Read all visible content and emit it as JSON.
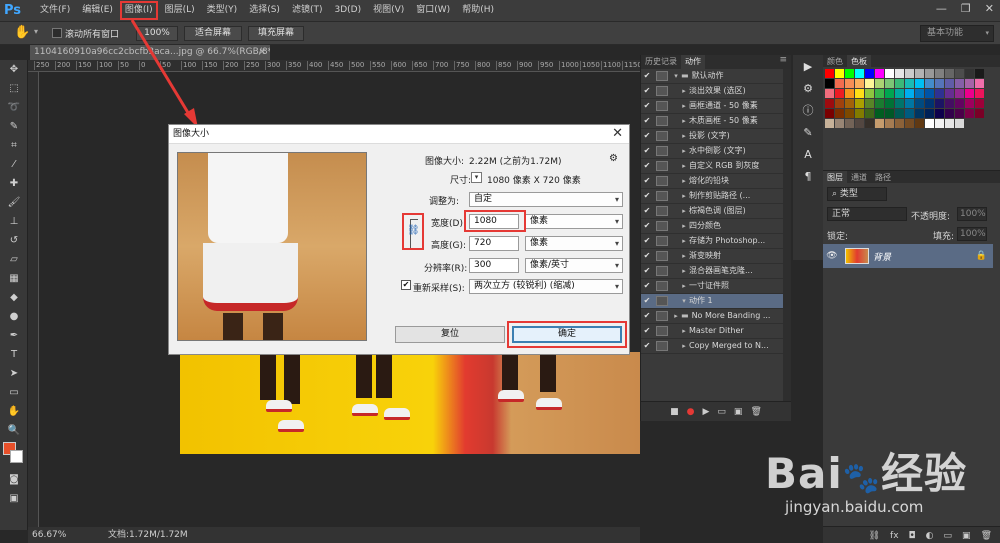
{
  "app": {
    "logo": "Ps"
  },
  "menu": [
    "文件(F)",
    "编辑(E)",
    "图像(I)",
    "图层(L)",
    "类型(Y)",
    "选择(S)",
    "滤镜(T)",
    "3D(D)",
    "视图(V)",
    "窗口(W)",
    "帮助(H)"
  ],
  "options_bar": {
    "scroll_all_label": "滚动所有窗口",
    "zoom_100": "100%",
    "fit_screen": "适合屏幕",
    "fill_screen": "填充屏幕",
    "workspace": "基本功能"
  },
  "document": {
    "tab_title": "1104160910a96cc2cbcfb3aca...jpg @ 66.7%(RGB/8*)",
    "ruler_ticks": [
      "250",
      "200",
      "150",
      "100",
      "50",
      "0",
      "50",
      "100",
      "150",
      "200",
      "250",
      "300",
      "350",
      "400",
      "450",
      "500",
      "550",
      "600",
      "650",
      "700",
      "750",
      "800",
      "850",
      "900",
      "950",
      "1000",
      "1050",
      "1100",
      "1150"
    ],
    "zoom": "66.67%",
    "doc_info": "文档:1.72M/1.72M"
  },
  "dialog": {
    "title": "图像大小",
    "image_size_label": "图像大小:",
    "image_size_value": "2.22M (之前为1.72M)",
    "dimensions_label": "尺寸:",
    "dimensions_value": "1080 像素  X  720 像素",
    "fit_to_label": "调整为:",
    "fit_to_value": "自定",
    "width_label": "宽度(D):",
    "width_value": "1080",
    "width_unit": "像素",
    "height_label": "高度(G):",
    "height_value": "720",
    "height_unit": "像素",
    "resolution_label": "分辨率(R):",
    "resolution_value": "300",
    "resolution_unit": "像素/英寸",
    "resample_label": "重新采样(S):",
    "resample_value": "两次立方 (较锐利) (缩减)",
    "reset_button": "复位",
    "ok_button": "确定"
  },
  "actions_panel": {
    "tabs": [
      "历史记录",
      "动作"
    ],
    "rows": [
      {
        "label": "默认动作",
        "type": "folder",
        "check": "✔"
      },
      {
        "label": "淡出效果 (选区)",
        "type": "action",
        "check": "✔"
      },
      {
        "label": "画框通道 - 50 像素",
        "type": "action",
        "check": "✔"
      },
      {
        "label": "木质画框 - 50 像素",
        "type": "action",
        "check": "✔"
      },
      {
        "label": "投影 (文字)",
        "type": "action",
        "check": "✔"
      },
      {
        "label": "水中倒影 (文字)",
        "type": "action",
        "check": "✔"
      },
      {
        "label": "自定义 RGB 到灰度",
        "type": "action",
        "check": "✔"
      },
      {
        "label": "熔化的铅块",
        "type": "action",
        "check": "✔"
      },
      {
        "label": "制作剪贴路径 (...",
        "type": "action",
        "check": "✔"
      },
      {
        "label": "棕褐色调 (图层)",
        "type": "action",
        "check": "✔"
      },
      {
        "label": "四分颜色",
        "type": "action",
        "check": "✔"
      },
      {
        "label": "存储为 Photoshop...",
        "type": "action",
        "check": "✔"
      },
      {
        "label": "渐变映射",
        "type": "action",
        "check": "✔"
      },
      {
        "label": "混合器画笔克隆...",
        "type": "action",
        "check": "✔"
      },
      {
        "label": "一寸证件照",
        "type": "action",
        "check": "✔"
      },
      {
        "label": "动作 1",
        "type": "action",
        "check": "✔"
      },
      {
        "label": "No More Banding ...",
        "type": "folder",
        "check": "✔"
      },
      {
        "label": "Master Dither",
        "type": "action",
        "check": "✔"
      },
      {
        "label": "Copy Merged to N...",
        "type": "action",
        "check": "✔"
      }
    ],
    "footer_icons": [
      "stop-icon",
      "record-icon",
      "play-icon",
      "folder-icon",
      "new-icon",
      "trash-icon"
    ]
  },
  "swatches": {
    "tabs": [
      "颜色",
      "色板"
    ],
    "colors": [
      "#ff0000",
      "#ffff00",
      "#00ff00",
      "#00ffff",
      "#0000ff",
      "#ff00ff",
      "#ffffff",
      "#e6e6e6",
      "#cccccc",
      "#b3b3b3",
      "#999999",
      "#808080",
      "#666666",
      "#4d4d4d",
      "#333333",
      "#1a1a1a",
      "#000000",
      "#f26c4f",
      "#f68e56",
      "#fbaf5d",
      "#fff799",
      "#acd373",
      "#7cc576",
      "#3bb878",
      "#1abbb4",
      "#00bff3",
      "#438ccb",
      "#5574b9",
      "#605ca8",
      "#855fa8",
      "#a763a8",
      "#f06eaa",
      "#f26d7d",
      "#ed1c24",
      "#f7941d",
      "#ffde17",
      "#8dc63f",
      "#39b54a",
      "#00a651",
      "#00a99d",
      "#00aeef",
      "#0072bc",
      "#0054a6",
      "#2e3192",
      "#662d91",
      "#92278f",
      "#ec008c",
      "#ed145b",
      "#9e0b0f",
      "#a0410d",
      "#a36209",
      "#aba000",
      "#598527",
      "#1a7b30",
      "#007236",
      "#00746b",
      "#0076a3",
      "#004a80",
      "#003471",
      "#1b1464",
      "#440e62",
      "#630460",
      "#9e005d",
      "#9e0039",
      "#790000",
      "#7b2e00",
      "#7d4900",
      "#827b00",
      "#406618",
      "#005e20",
      "#005826",
      "#005952",
      "#005b7f",
      "#003663",
      "#002157",
      "#0d004c",
      "#32004b",
      "#4b0049",
      "#7b0046",
      "#7a0026",
      "#c7b299",
      "#998675",
      "#736357",
      "#534741",
      "#37302a",
      "#c69c6d",
      "#a67c52",
      "#8c6239",
      "#754c24",
      "#603913",
      "#ffffff",
      "#f2f2f2",
      "#e6e6e6",
      "#d9d9d9"
    ]
  },
  "layers": {
    "tabs": [
      "图层",
      "通道",
      "路径"
    ],
    "filter_label": "类型",
    "blend_mode": "正常",
    "opacity_label": "不透明度:",
    "opacity_value": "100%",
    "lock_label": "锁定:",
    "fill_label": "填充:",
    "fill_value": "100%",
    "layer_name": "背景",
    "footer_icons": [
      "link-icon",
      "fx-icon",
      "mask-icon",
      "adjust-icon",
      "group-icon",
      "new-layer-icon",
      "trash-icon"
    ]
  },
  "watermark": {
    "main": "Bai",
    "main2": "经验",
    "sub": "jingyan.baidu.com"
  },
  "colors": {
    "highlight": "#e53935",
    "selection": "#5a6b85",
    "ps_blue": "#41a7ff"
  }
}
